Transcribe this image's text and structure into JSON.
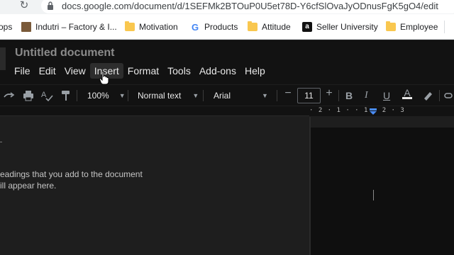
{
  "browser": {
    "url": "docs.google.com/document/d/1SEFMk2BTOuP0U5et78D-Y6cfSlOvaJyODnusFgK5gO4/edit"
  },
  "bookmarks": {
    "items": [
      {
        "label": "ops",
        "icon": "apps-icon"
      },
      {
        "label": "Indutri – Factory & I...",
        "icon": "site-favicon"
      },
      {
        "label": "Motivation",
        "icon": "folder-icon"
      },
      {
        "label": "Products",
        "icon": "google-icon"
      },
      {
        "label": "Attitude",
        "icon": "folder-icon"
      },
      {
        "label": "Seller University",
        "icon": "amazon-icon"
      },
      {
        "label": "Employee",
        "icon": "folder-icon"
      }
    ]
  },
  "docs": {
    "title": "Untitled document",
    "menu": [
      "File",
      "Edit",
      "View",
      "Insert",
      "Format",
      "Tools",
      "Add-ons",
      "Help"
    ],
    "active_menu": "Insert"
  },
  "toolbar": {
    "zoom": "100%",
    "style": "Normal text",
    "font": "Arial",
    "font_size": "11",
    "minus": "−",
    "plus": "+"
  },
  "ruler": {
    "text": "· 2 · 1 ·   · 1 · 2 · 3"
  },
  "outline": {
    "line1": "eadings that you add to the document",
    "line2": "ill appear here."
  },
  "colors": {
    "background": "#1e1e1e",
    "header": "#121212",
    "accent_blue": "#4285f4",
    "folder": "#f9c74f"
  }
}
